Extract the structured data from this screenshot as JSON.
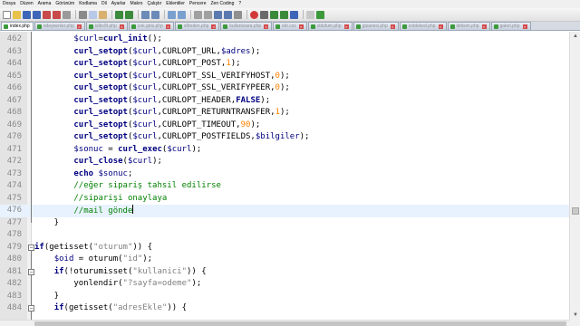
{
  "menubar": {
    "items": [
      "Dosya",
      "Düzen",
      "Arama",
      "Görünüm",
      "Kodlama",
      "Dil",
      "Ayarlar",
      "Makro",
      "Çalıştır",
      "Eklentiler",
      "Pencere",
      "Zen Coding",
      "?"
    ]
  },
  "tabs": [
    {
      "label": "index.php",
      "active": true
    },
    {
      "label": "odeyeenler.php",
      "active": false
    },
    {
      "label": "islbs9t.php",
      "active": false
    },
    {
      "label": "cok.giris.php",
      "active": false
    },
    {
      "label": "sifreden.php",
      "active": false
    },
    {
      "label": "kullaniciara.php",
      "active": false
    },
    {
      "label": "ekt.css",
      "active": false
    },
    {
      "label": "stilufum.php",
      "active": false
    },
    {
      "label": "gisanesi.php",
      "active": false
    },
    {
      "label": "cnbleked.php",
      "active": false
    },
    {
      "label": "iletisim.php",
      "active": false
    },
    {
      "label": "galeri.php",
      "active": false
    }
  ],
  "editor": {
    "caret_line": 476,
    "lines": [
      {
        "num": "462",
        "text": "        $curl=curl_init();"
      },
      {
        "num": "463",
        "text": "        curl_setopt($curl,CURLOPT_URL,$adres);"
      },
      {
        "num": "464",
        "text": "        curl_setopt($curl,CURLOPT_POST,1);"
      },
      {
        "num": "465",
        "text": "        curl_setopt($curl,CURLOPT_SSL_VERIFYHOST,0);"
      },
      {
        "num": "466",
        "text": "        curl_setopt($curl,CURLOPT_SSL_VERIFYPEER,0);"
      },
      {
        "num": "467",
        "text": "        curl_setopt($curl,CURLOPT_HEADER,FALSE);"
      },
      {
        "num": "468",
        "text": "        curl_setopt($curl,CURLOPT_RETURNTRANSFER,1);"
      },
      {
        "num": "469",
        "text": "        curl_setopt($curl,CURLOPT_TIMEOUT,90);"
      },
      {
        "num": "470",
        "text": "        curl_setopt($curl,CURLOPT_POSTFIELDS,$bilgiler);"
      },
      {
        "num": "471",
        "text": "        $sonuc = curl_exec($curl);"
      },
      {
        "num": "472",
        "text": "        curl_close($curl);"
      },
      {
        "num": "473",
        "text": "        echo $sonuc;"
      },
      {
        "num": "474",
        "text": "        //eğer sipariş tahsil edilirse"
      },
      {
        "num": "475",
        "text": "        //siparişi onaylaya"
      },
      {
        "num": "476",
        "text": "        //mail gönde"
      },
      {
        "num": "477",
        "text": "    }"
      },
      {
        "num": "478",
        "text": ""
      },
      {
        "num": "479",
        "text": "if(getisset(\"oturum\")) {"
      },
      {
        "num": "480",
        "text": "    $oid = oturum(\"id\");"
      },
      {
        "num": "481",
        "text": "    if(!oturumisset(\"kullanici\")) {"
      },
      {
        "num": "482",
        "text": "        yonlendir(\"?sayfa=odeme\");"
      },
      {
        "num": "483",
        "text": "    }"
      },
      {
        "num": "484",
        "text": "    if(getisset(\"adresEkle\")) {"
      }
    ]
  }
}
